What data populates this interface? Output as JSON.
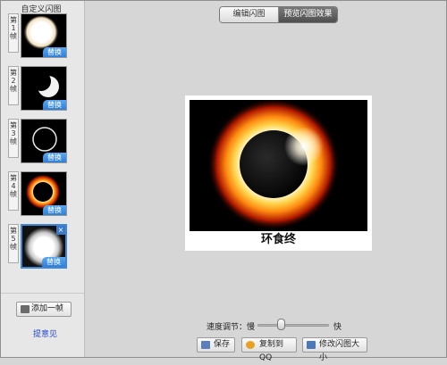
{
  "left_panel": {
    "title": "自定义闪图",
    "frames": [
      {
        "label": "第\n1\n帧",
        "replace": "替换"
      },
      {
        "label": "第\n2\n帧",
        "replace": "替换"
      },
      {
        "label": "第\n3\n帧",
        "replace": "替换"
      },
      {
        "label": "第\n4\n帧",
        "replace": "替换"
      },
      {
        "label": "第\n5\n帧",
        "replace": "替换",
        "close": "×"
      }
    ],
    "add_frame": "添加一帧",
    "feedback": "提意见"
  },
  "tabs": [
    {
      "label": "编辑闪图",
      "active": false
    },
    {
      "label": "预览闪图效果",
      "active": true
    }
  ],
  "preview": {
    "caption": "环食终"
  },
  "speed": {
    "label": "速度调节：慢",
    "fast": "快",
    "level": 0.3
  },
  "buttons": {
    "save": "保存",
    "copy_qq": "复制到QQ",
    "resize": "修改闪图大小"
  },
  "colors": {
    "accent": "#3f86d8",
    "link": "#2547c8"
  }
}
